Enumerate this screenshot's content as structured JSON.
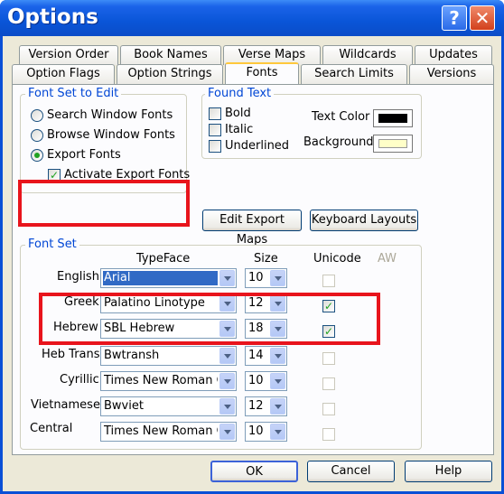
{
  "window": {
    "title": "Options",
    "help_label": "?",
    "close_label": "✕"
  },
  "tabs": {
    "row1": [
      "Version Order",
      "Book Names",
      "Verse Maps",
      "Wildcards",
      "Updates"
    ],
    "row2": [
      "Option Flags",
      "Option Strings",
      "Fonts",
      "Search Limits",
      "Versions"
    ],
    "active": "Fonts"
  },
  "font_set_to_edit": {
    "label": "Font Set to Edit",
    "options": [
      "Search Window Fonts",
      "Browse Window Fonts",
      "Export Fonts"
    ],
    "selected": "Export Fonts",
    "activate_export_fonts": {
      "label": "Activate Export Fonts",
      "checked": true
    }
  },
  "found_text": {
    "label": "Found Text",
    "bold": "Bold",
    "italic": "Italic",
    "underlined": "Underlined",
    "text_color_label": "Text Color",
    "background_label": "Background",
    "text_color": "#000000",
    "background_color": "#ffffc8"
  },
  "buttons": {
    "edit_export_maps": "Edit Export Maps",
    "keyboard_layouts": "Keyboard Layouts",
    "ok": "OK",
    "cancel": "Cancel",
    "help": "Help"
  },
  "font_set": {
    "label": "Font Set",
    "headers": {
      "typeface": "TypeFace",
      "size": "Size",
      "unicode": "Unicode",
      "aw": "AW"
    },
    "rows": [
      {
        "name": "English",
        "typeface": "Arial",
        "size": "10",
        "unicode": false
      },
      {
        "name": "Greek",
        "typeface": "Palatino Linotype",
        "size": "12",
        "unicode": true
      },
      {
        "name": "Hebrew",
        "typeface": "SBL Hebrew",
        "size": "18",
        "unicode": true
      },
      {
        "name": "Heb Trans",
        "typeface": "Bwtransh",
        "size": "14",
        "unicode": false
      },
      {
        "name": "Cyrillic",
        "typeface": "Times New Roman C",
        "size": "10",
        "unicode": false
      },
      {
        "name": "Vietnamese",
        "typeface": "Bwviet",
        "size": "12",
        "unicode": false
      },
      {
        "name": "Central",
        "typeface": "Times New Roman C",
        "size": "10",
        "unicode": false
      }
    ]
  },
  "colors": {
    "highlight": "#e8141c",
    "accent": "#0046d5",
    "selection": "#316ac5"
  }
}
